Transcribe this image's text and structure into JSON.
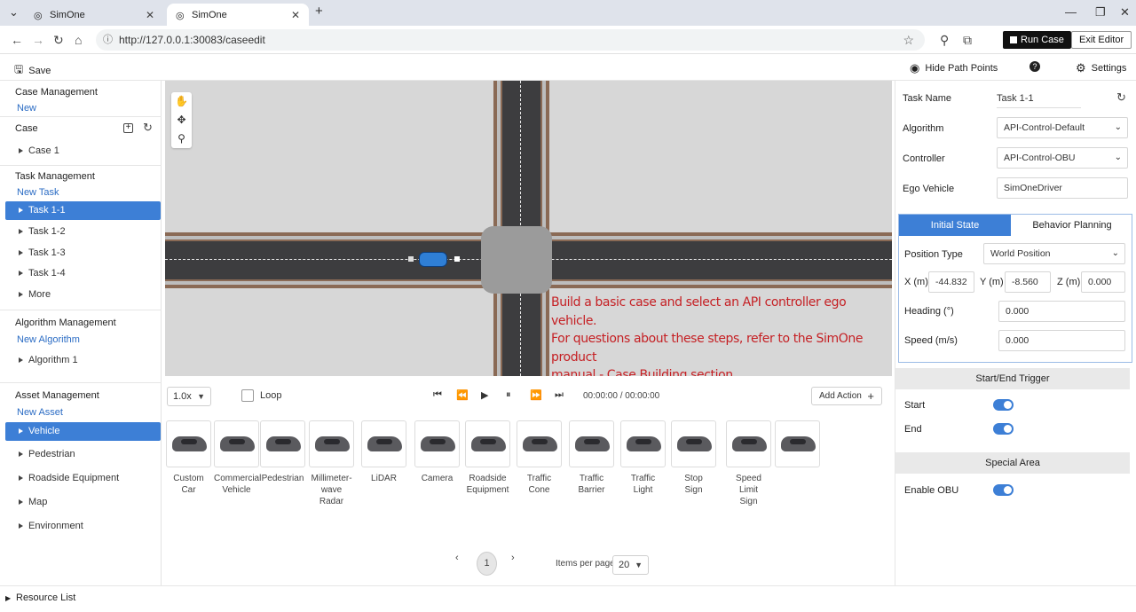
{
  "browser": {
    "tabs": [
      {
        "title": "SimOne",
        "active": false
      },
      {
        "title": "SimOne",
        "active": true
      }
    ],
    "url": "http://127.0.0.1:30083/caseedit",
    "run_case": "Run Case",
    "exit_editor": "Exit Editor"
  },
  "toolbar": {
    "save": "Save",
    "hide_path": "Hide Path Points",
    "settings": "Settings"
  },
  "sidebar": {
    "case_management": {
      "title": "Case Management",
      "link": "New"
    },
    "case": {
      "title": "Case",
      "items": [
        "Case 1"
      ]
    },
    "task_management": {
      "title": "Task Management",
      "link": "New Task",
      "items": [
        "Task 1-1",
        "Task 1-2",
        "Task 1-3",
        "Task 1-4",
        "More"
      ],
      "selected": "Task 1-1"
    },
    "algorithm_management": {
      "title": "Algorithm Management",
      "link": "New Algorithm",
      "items": [
        "Algorithm 1"
      ]
    },
    "asset_management": {
      "title": "Asset Management",
      "link": "New Asset",
      "items": [
        "Vehicle",
        "Pedestrian",
        "Roadside Equipment",
        "Map",
        "Environment"
      ],
      "selected": "Vehicle"
    }
  },
  "map": {
    "hint_lines": [
      "Build a basic case and select an API controller ego vehicle.",
      "For questions about these steps, refer to the SimOne product",
      "manual - Case Building section."
    ]
  },
  "playback": {
    "speed": "1.0x",
    "loop": "Loop",
    "time": "00:00:00 / 00:00:00",
    "add_action": "Add Action"
  },
  "assets": [
    [
      "Custom",
      "Car"
    ],
    [
      "Commercial",
      "Vehicle"
    ],
    [
      "Pedestrian"
    ],
    [
      "Millimeter-",
      "wave",
      "Radar"
    ],
    [
      "LiDAR"
    ],
    [
      "Camera"
    ],
    [
      "Roadside",
      "Equipment"
    ],
    [
      "Traffic",
      "Cone"
    ],
    [
      "Traffic",
      "Barrier"
    ],
    [
      "Traffic",
      "Light"
    ],
    [
      "Stop",
      "Sign"
    ],
    [
      "Speed Limit",
      "Sign"
    ],
    [
      ""
    ]
  ],
  "pagination": {
    "page": "1",
    "items_per_page_label": "Items per page:",
    "items_per_page": "20"
  },
  "panel": {
    "task_name_label": "Task Name",
    "task_name": "Task 1-1",
    "algorithm_label": "Algorithm",
    "algorithm": "API-Control-Default",
    "controller_label": "Controller",
    "controller": "API-Control-OBU",
    "ego_label": "Ego Vehicle",
    "ego": "SimOneDriver",
    "tabs": [
      "Initial State",
      "Behavior Planning"
    ],
    "position_type_label": "Position Type",
    "position_type": "World Position",
    "x_label": "X (m)",
    "x": "-44.832",
    "y_label": "Y (m)",
    "y": "-8.560",
    "z_label": "Z (m)",
    "z": "0.000",
    "heading_label": "Heading (°)",
    "heading": "0.000",
    "speed_label": "Speed (m/s)",
    "speed": "0.000",
    "trigger_title": "Start/End Trigger",
    "start_label": "Start",
    "start_on": true,
    "end_label": "End",
    "end_on": true,
    "special_title": "Special Area",
    "obu_label": "Enable OBU",
    "obu_on": true
  },
  "footer": {
    "resource_list": "Resource List"
  },
  "colors": {
    "accent": "#3d7fd6",
    "hint": "#c52024"
  }
}
